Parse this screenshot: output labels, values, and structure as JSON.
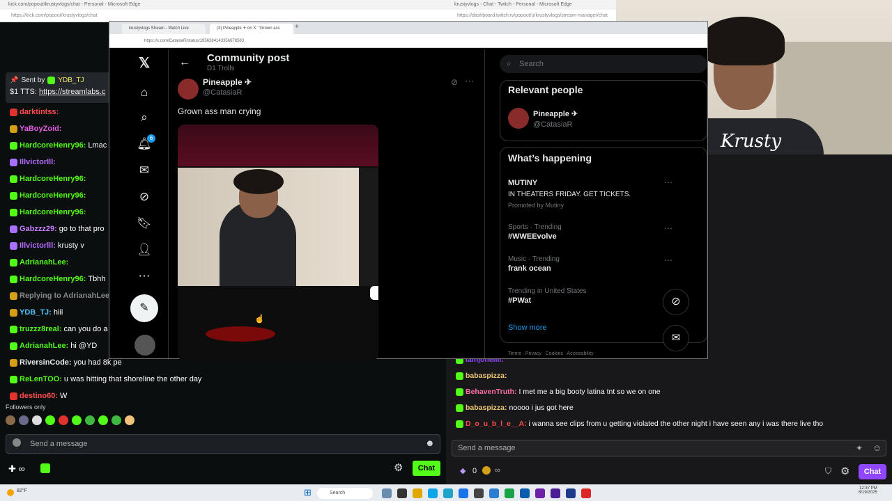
{
  "kick": {
    "title": "kick.com/popout/krustyvlogs/chat - Personal - Microsoft Edge",
    "url": "https://kick.com/popout/krustyvlogs/chat",
    "pinned": {
      "sender": "Sent by",
      "user": "YDB_TJ",
      "line": "$1 TTS:",
      "link": "https://streamlabs.c"
    },
    "messages": [
      {
        "user": "darktintss:",
        "text": "",
        "color": "#ff4d4d"
      },
      {
        "user": "YaBoyZoid:",
        "text": "",
        "color": "#e05fe0"
      },
      {
        "user": "HardcoreHenry96:",
        "text": "Lmac",
        "color": "#53fc18"
      },
      {
        "user": "Illvictorlll:",
        "text": "",
        "color": "#b36bff"
      },
      {
        "user": "HardcoreHenry96:",
        "text": "",
        "color": "#53fc18"
      },
      {
        "user": "HardcoreHenry96:",
        "text": "",
        "color": "#53fc18"
      },
      {
        "user": "HardcoreHenry96:",
        "text": "",
        "color": "#53fc18"
      },
      {
        "user": "Gabzzz29:",
        "text": "go to that pro",
        "color": "#c77dff"
      },
      {
        "user": "Illvictorlll:",
        "text": "krusty v",
        "color": "#b36bff"
      },
      {
        "user": "AdrianahLee:",
        "text": "",
        "color": "#53fc18"
      },
      {
        "user": "HardcoreHenry96:",
        "text": "Tbhh",
        "color": "#53fc18"
      },
      {
        "user": "Replying to AdrianahLee:",
        "text": "",
        "color": "#888888"
      },
      {
        "user": "YDB_TJ:",
        "text": "hiii",
        "color": "#4fc3f7"
      },
      {
        "user": "truzzz8real:",
        "text": "can you do a",
        "color": "#53fc18"
      },
      {
        "user": "AdrianahLee:",
        "text": "hi @YD",
        "color": "#53fc18"
      },
      {
        "user": "RiversinCode:",
        "text": "you had 8k pe",
        "color": "#e7e9ea"
      },
      {
        "user": "ReLenTOO:",
        "text": "u was hitting that shoreline the other day",
        "color": "#53fc18"
      },
      {
        "user": "destino60:",
        "text": "W",
        "color": "#ff4d4d"
      }
    ],
    "followers_only": "Followers only",
    "input_placeholder": "Send a message",
    "chat_button": "Chat"
  },
  "twitch": {
    "title": "krustyvlogs - Chat - Twitch - Personal - Microsoft Edge",
    "url": "https://dashboard.twitch.tv/popout/u/krustyvlogs/stream-manager/chat",
    "messages": [
      {
        "user": "iamjonellll:",
        "text": "",
        "color": "#9147ff"
      },
      {
        "user": "babaspizza:",
        "text": "",
        "color": "#f0c674"
      },
      {
        "user": "BehavenTruth:",
        "text": "I met me a big booty latina tnt so we on one",
        "color": "#ff6fa8"
      },
      {
        "user": "babaspizza:",
        "text": "noooo i jus got here",
        "color": "#f0c674"
      },
      {
        "user": "D_o_u_b_l_e__A:",
        "text": "i wanna see clips from u getting violated the other night i have seen any i was there live tho",
        "color": "#ff4d4d"
      }
    ],
    "input_placeholder": "Send a message",
    "points": "0",
    "chat_button": "Chat"
  },
  "x": {
    "tabs": [
      "krustyvlogs Stream - Watch Live",
      "(3) Pineapple ✈ on X: \"Grown ass"
    ],
    "url": "https://x.com/CataslaR/status/1956384143356678583",
    "header": "Community post",
    "community": "D1 Trolls",
    "author_name": "Pineapple ✈",
    "author_handle": "@CatasiaR",
    "post_text": "Grown ass man crying",
    "notification_count": "6",
    "search_placeholder": "Search",
    "relevant_title": "Relevant people",
    "relevant_name": "Pineapple ✈",
    "relevant_handle": "@CatasiaR",
    "happening_title": "What’s happening",
    "promo_title": "MUTINY",
    "promo_text": "IN THEATERS FRIDAY. GET TICKETS.",
    "promo_by": "Promoted by Mutiny",
    "trends": [
      {
        "context": "Sports · Trending",
        "name": "#WWEEvolve"
      },
      {
        "context": "Music · Trending",
        "name": "frank ocean"
      },
      {
        "context": "Trending in United States",
        "name": "#PWat"
      }
    ],
    "show_more": "Show more",
    "footer_links": "Terms   Privacy   Cookies   Accessibility"
  },
  "taskbar": {
    "search": "Search",
    "weather": "82°F",
    "time": "12:37 PM",
    "date": "8/19/2025"
  }
}
